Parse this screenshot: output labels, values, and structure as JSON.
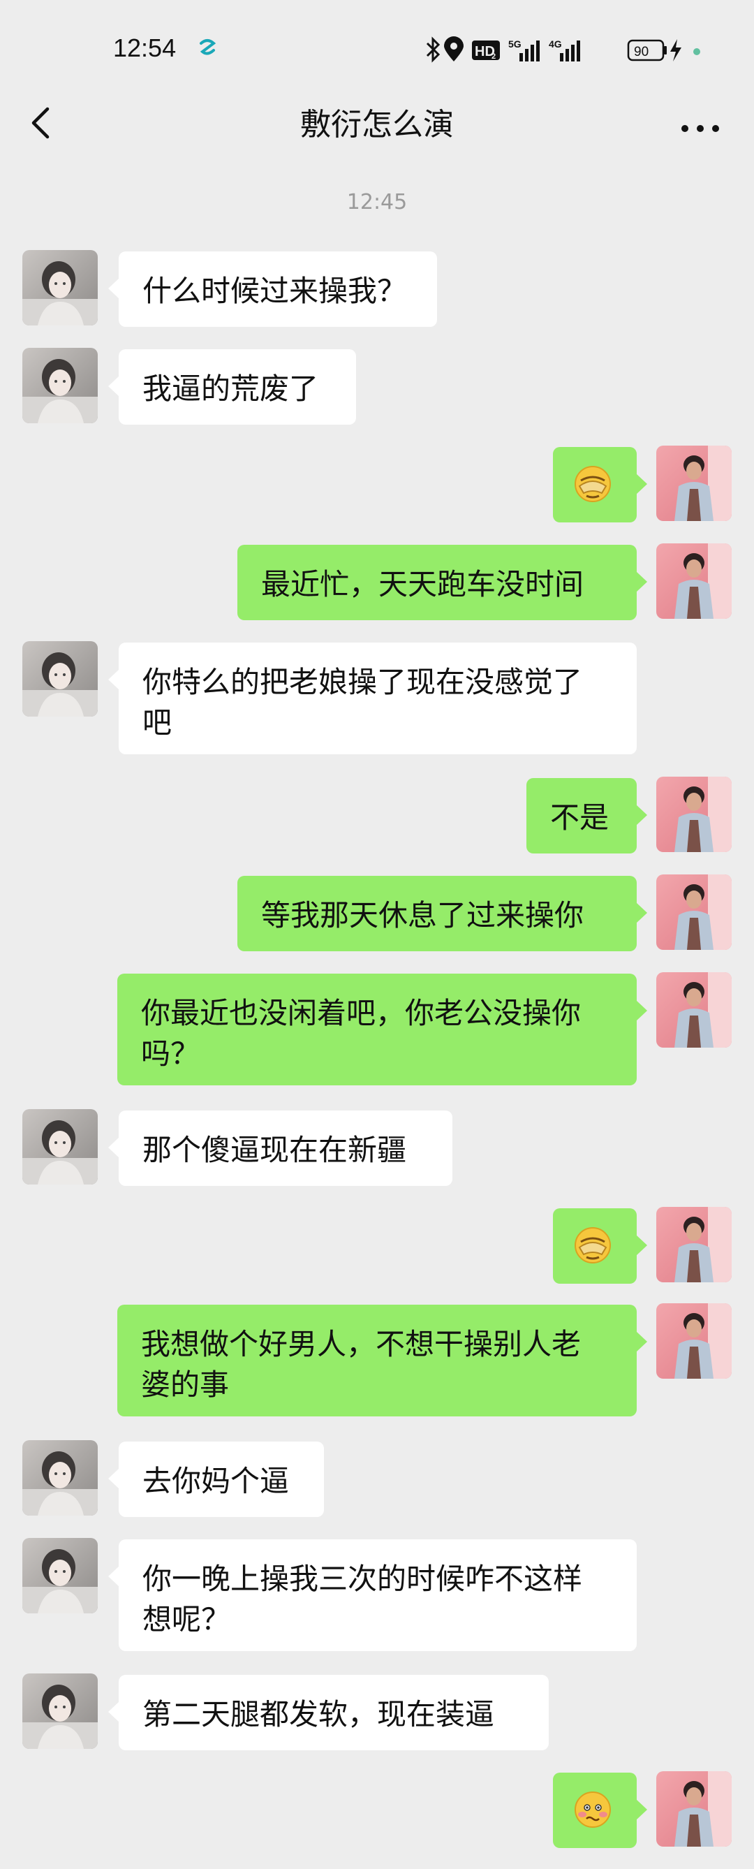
{
  "status_bar": {
    "time": "12:54",
    "battery": "90",
    "network_1": "5G",
    "network_2": "4G",
    "hd_badge": "HD",
    "hd_sub": "2"
  },
  "header": {
    "title": "敷衍怎么演",
    "back_icon": "chevron-left-icon",
    "more_icon": "more-dots-icon"
  },
  "chat": {
    "timestamp": "12:45",
    "messages": [
      {
        "side": "in",
        "text": "什么时候过来操我？"
      },
      {
        "side": "in",
        "text": "我逼的荒废了"
      },
      {
        "side": "out",
        "emoji": "facepalm-emoji"
      },
      {
        "side": "out",
        "text": "最近忙，天天跑车没时间"
      },
      {
        "side": "in",
        "line1": "你特么的把老娘操了现在没感觉了",
        "line2": "吧"
      },
      {
        "side": "out",
        "text": "不是"
      },
      {
        "side": "out",
        "text": "等我那天休息了过来操你"
      },
      {
        "side": "out",
        "line1": "你最近也没闲着吧，你老公没操你",
        "line2": "吗？"
      },
      {
        "side": "in",
        "text": "那个傻逼现在在新疆"
      },
      {
        "side": "out",
        "emoji": "facepalm-emoji"
      },
      {
        "side": "out",
        "line1": "我想做个好男人，不想干操别人老",
        "line2": "婆的事"
      },
      {
        "side": "in",
        "text": "去你妈个逼"
      },
      {
        "side": "in",
        "line1": "你一晚上操我三次的时候咋不这样",
        "line2": "想呢？"
      },
      {
        "side": "in",
        "text": "第二天腿都发软，现在装逼"
      },
      {
        "side": "out",
        "emoji": "blushing-awkward-emoji"
      }
    ]
  },
  "colors": {
    "background": "#ededed",
    "incoming_bubble": "#ffffff",
    "outgoing_bubble": "#95ec69",
    "timestamp": "#9a9a9a"
  }
}
